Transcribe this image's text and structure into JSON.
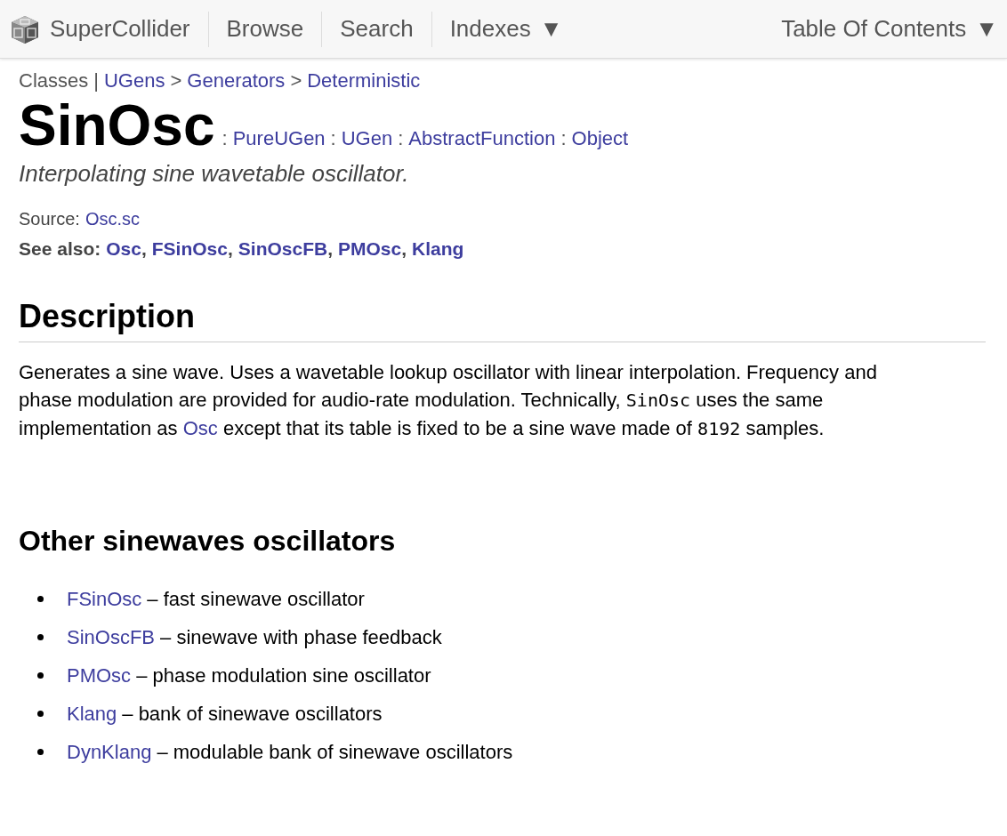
{
  "nav": {
    "items": [
      {
        "label": "SuperCollider",
        "kind": "home"
      },
      {
        "label": "Browse",
        "kind": "plain"
      },
      {
        "label": "Search",
        "kind": "plain"
      },
      {
        "label": "Indexes",
        "kind": "menu",
        "caret": "▼"
      },
      {
        "label": "Table Of Contents",
        "kind": "menu-right",
        "caret": "▼"
      }
    ]
  },
  "breadcrumb": [
    {
      "kind": "text",
      "text": "Classes"
    },
    {
      "kind": "sep",
      "text": "|"
    },
    {
      "kind": "link",
      "text": "UGens"
    },
    {
      "kind": "sep",
      "text": ">"
    },
    {
      "kind": "link",
      "text": "Generators"
    },
    {
      "kind": "sep",
      "text": ">"
    },
    {
      "kind": "link",
      "text": "Deterministic"
    }
  ],
  "title": "SinOsc",
  "superclasses": [
    {
      "kind": "sep",
      "text": ":"
    },
    {
      "kind": "link",
      "text": "PureUGen"
    },
    {
      "kind": "sep",
      "text": ":"
    },
    {
      "kind": "link",
      "text": "UGen"
    },
    {
      "kind": "sep",
      "text": ":"
    },
    {
      "kind": "link",
      "text": "AbstractFunction"
    },
    {
      "kind": "sep",
      "text": ":"
    },
    {
      "kind": "link",
      "text": "Object"
    }
  ],
  "summary": "Interpolating sine wavetable oscillator.",
  "source": {
    "label": "Source:",
    "link": "Osc.sc"
  },
  "see_also": {
    "label": "See also:",
    "links": [
      {
        "kind": "link",
        "text": "Osc"
      },
      {
        "kind": "sep",
        "text": ","
      },
      {
        "kind": "link",
        "text": "FSinOsc"
      },
      {
        "kind": "sep",
        "text": ","
      },
      {
        "kind": "link",
        "text": "SinOscFB"
      },
      {
        "kind": "sep",
        "text": ","
      },
      {
        "kind": "link",
        "text": "PMOsc"
      },
      {
        "kind": "sep",
        "text": ","
      },
      {
        "kind": "link",
        "text": "Klang"
      }
    ]
  },
  "description": {
    "heading": "Description",
    "paragraph": [
      {
        "kind": "text",
        "text": "Generates a sine wave. Uses a wavetable lookup oscillator with linear interpolation. Frequency and phase modulation are provided for audio-rate modulation. Technically, "
      },
      {
        "kind": "code",
        "text": "SinOsc"
      },
      {
        "kind": "text",
        "text": " uses the same implementation as "
      },
      {
        "kind": "link",
        "text": "Osc"
      },
      {
        "kind": "text",
        "text": " except that its table is fixed to be a sine wave made of "
      },
      {
        "kind": "code",
        "text": "8192"
      },
      {
        "kind": "text",
        "text": " samples."
      }
    ]
  },
  "other": {
    "heading": "Other sinewaves oscillators",
    "items": [
      {
        "link": "FSinOsc",
        "text": "– fast sinewave oscillator"
      },
      {
        "link": "SinOscFB",
        "text": "– sinewave with phase feedback"
      },
      {
        "link": "PMOsc",
        "text": "– phase modulation sine oscillator"
      },
      {
        "link": "Klang",
        "text": "– bank of sinewave oscillators"
      },
      {
        "link": "DynKlang",
        "text": "– modulable bank of sinewave oscillators"
      }
    ]
  }
}
